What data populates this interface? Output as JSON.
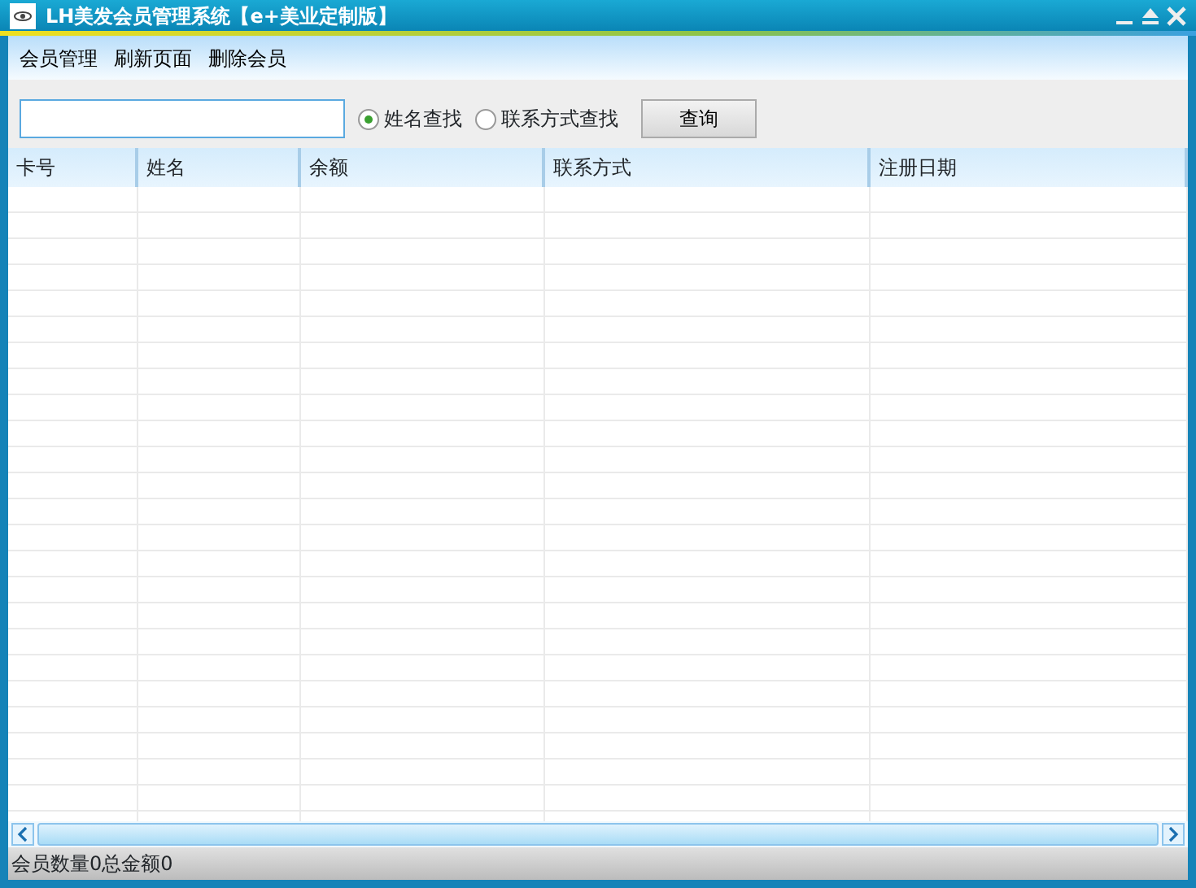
{
  "window": {
    "title": "LH美发会员管理系统【e+美业定制版】"
  },
  "menu": [
    "会员管理",
    "刷新页面",
    "删除会员"
  ],
  "search": {
    "options": [
      {
        "label": "姓名查找",
        "selected": true
      },
      {
        "label": "联系方式查找",
        "selected": false
      }
    ],
    "button": "查询"
  },
  "table": {
    "columns": [
      "卡号",
      "姓名",
      "余额",
      "联系方式",
      "注册日期"
    ]
  },
  "status_bar": "会员数量0总金额0"
}
